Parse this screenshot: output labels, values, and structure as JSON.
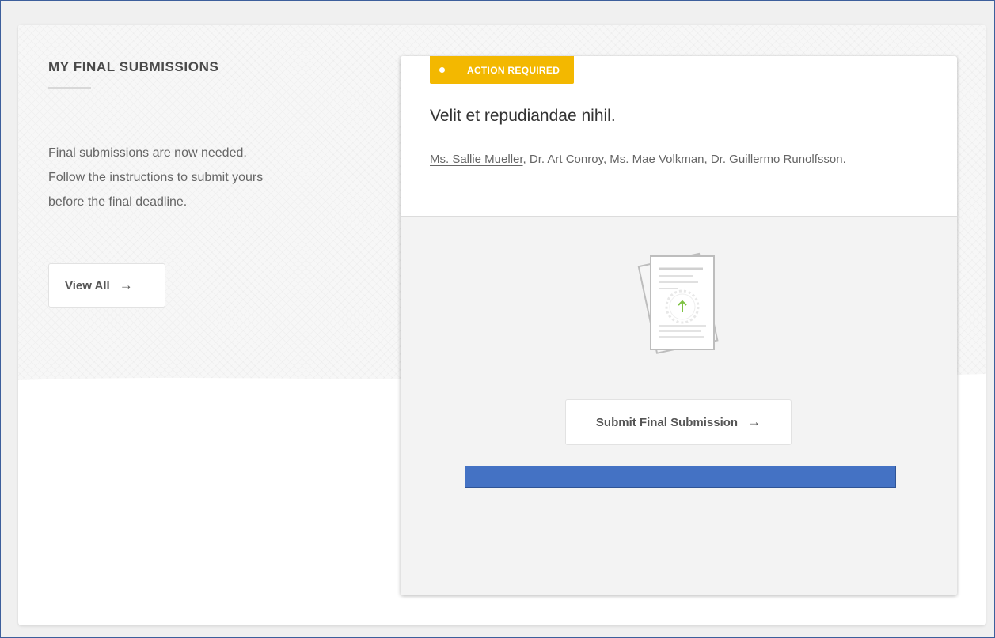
{
  "section": {
    "heading": "MY FINAL SUBMISSIONS",
    "description_lines": [
      "Final submissions are now needed.",
      "Follow the instructions to submit yours",
      "before the final deadline."
    ],
    "view_all_label": "View All",
    "arrow_glyph": "→"
  },
  "card": {
    "badge_label": "ACTION REQUIRED",
    "badge_color": "#f3b800",
    "title": "Velit et repudiandae nihil.",
    "primary_author": "Ms. Sallie Mueller",
    "other_authors": ", Dr. Art Conroy, Ms. Mae Volkman, Dr. Guillermo Runolfsson.",
    "illustration_icon": "document-upload-icon",
    "submit_label": "Submit Final Submission",
    "arrow_glyph": "→"
  },
  "colors": {
    "accent_upload": "#7dc242",
    "highlight_bar": "#4472c4"
  }
}
